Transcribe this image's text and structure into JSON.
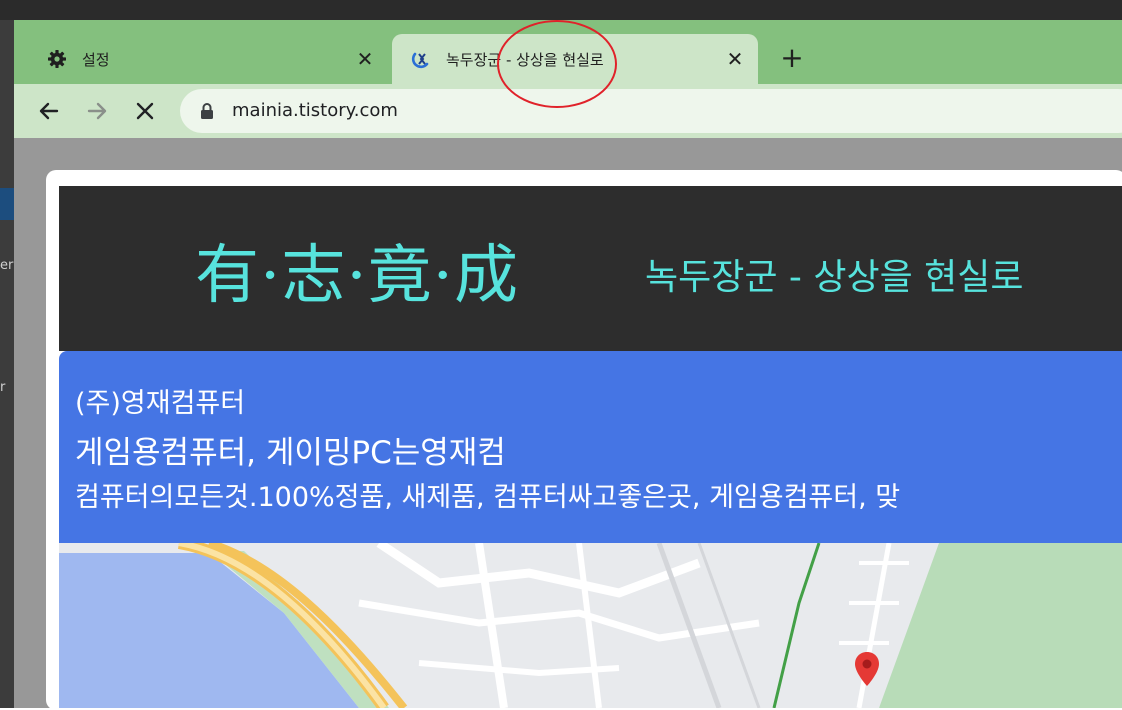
{
  "browser": {
    "tabs": [
      {
        "title": "설정",
        "icon": "gear-icon",
        "active": false
      },
      {
        "title": "녹두장군 - 상상을 현실로",
        "icon": "site-favicon-icon",
        "active": true
      }
    ],
    "close_glyph": "✕",
    "new_tab_glyph": "+",
    "url": "mainia.tistory.com",
    "nav_icons": [
      "back-arrow-icon",
      "forward-arrow-icon",
      "stop-loading-icon",
      "lock-icon"
    ]
  },
  "page": {
    "logo": "有·志·竟·成",
    "title": "녹두장군 - 상상을 현실로"
  },
  "ad": {
    "company": "(주)영재컴퓨터",
    "headline": "게임용컴퓨터, 게이밍PC는영재컴",
    "description": "컴퓨터의모든것.100%정품, 새제품, 컴퓨터싸고좋은곳, 게임용컴퓨터, 맞"
  },
  "background_fragments": [
    "er",
    "r"
  ],
  "colors": {
    "tabbar": "#84c07e",
    "active_tab": "#cde5c8",
    "header_bg": "#2d2d2d",
    "header_text": "#57e3dd",
    "ad_bg": "#4575e4",
    "annotation": "#e0222a"
  }
}
